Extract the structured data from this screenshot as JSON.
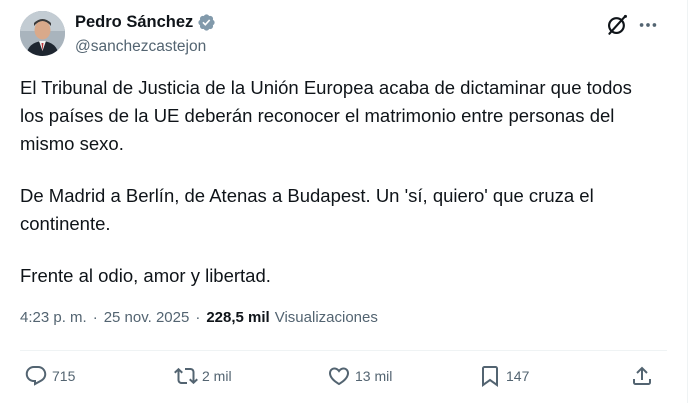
{
  "author": {
    "name": "Pedro Sánchez",
    "handle": "@sanchezcastejon"
  },
  "icons": {
    "verified": "verified-badge-icon",
    "grok": "grok-icon",
    "more": "more-options-icon",
    "reply": "reply-icon",
    "retweet": "retweet-icon",
    "like": "heart-icon",
    "bookmark": "bookmark-icon",
    "share": "share-icon"
  },
  "colors": {
    "verified": "#829aab",
    "secondary_text": "#536471",
    "primary_text": "#0f1419"
  },
  "tweet": {
    "paragraphs": [
      "El Tribunal de Justicia de la Unión Europea acaba de dictaminar que todos los países de la UE deberán reconocer el matrimonio entre personas del mismo sexo.",
      "De Madrid a Berlín, de Atenas a Budapest. Un 'sí, quiero' que cruza el continente.",
      "Frente al odio, amor y libertad."
    ],
    "time": "4:23 p. m.",
    "separator": "·",
    "date": "25 nov. 2025",
    "views_count": "228,5 mil",
    "views_label": "Visualizaciones"
  },
  "actions": {
    "replies": "715",
    "retweets": "2 mil",
    "likes": "13 mil",
    "bookmarks": "147"
  }
}
